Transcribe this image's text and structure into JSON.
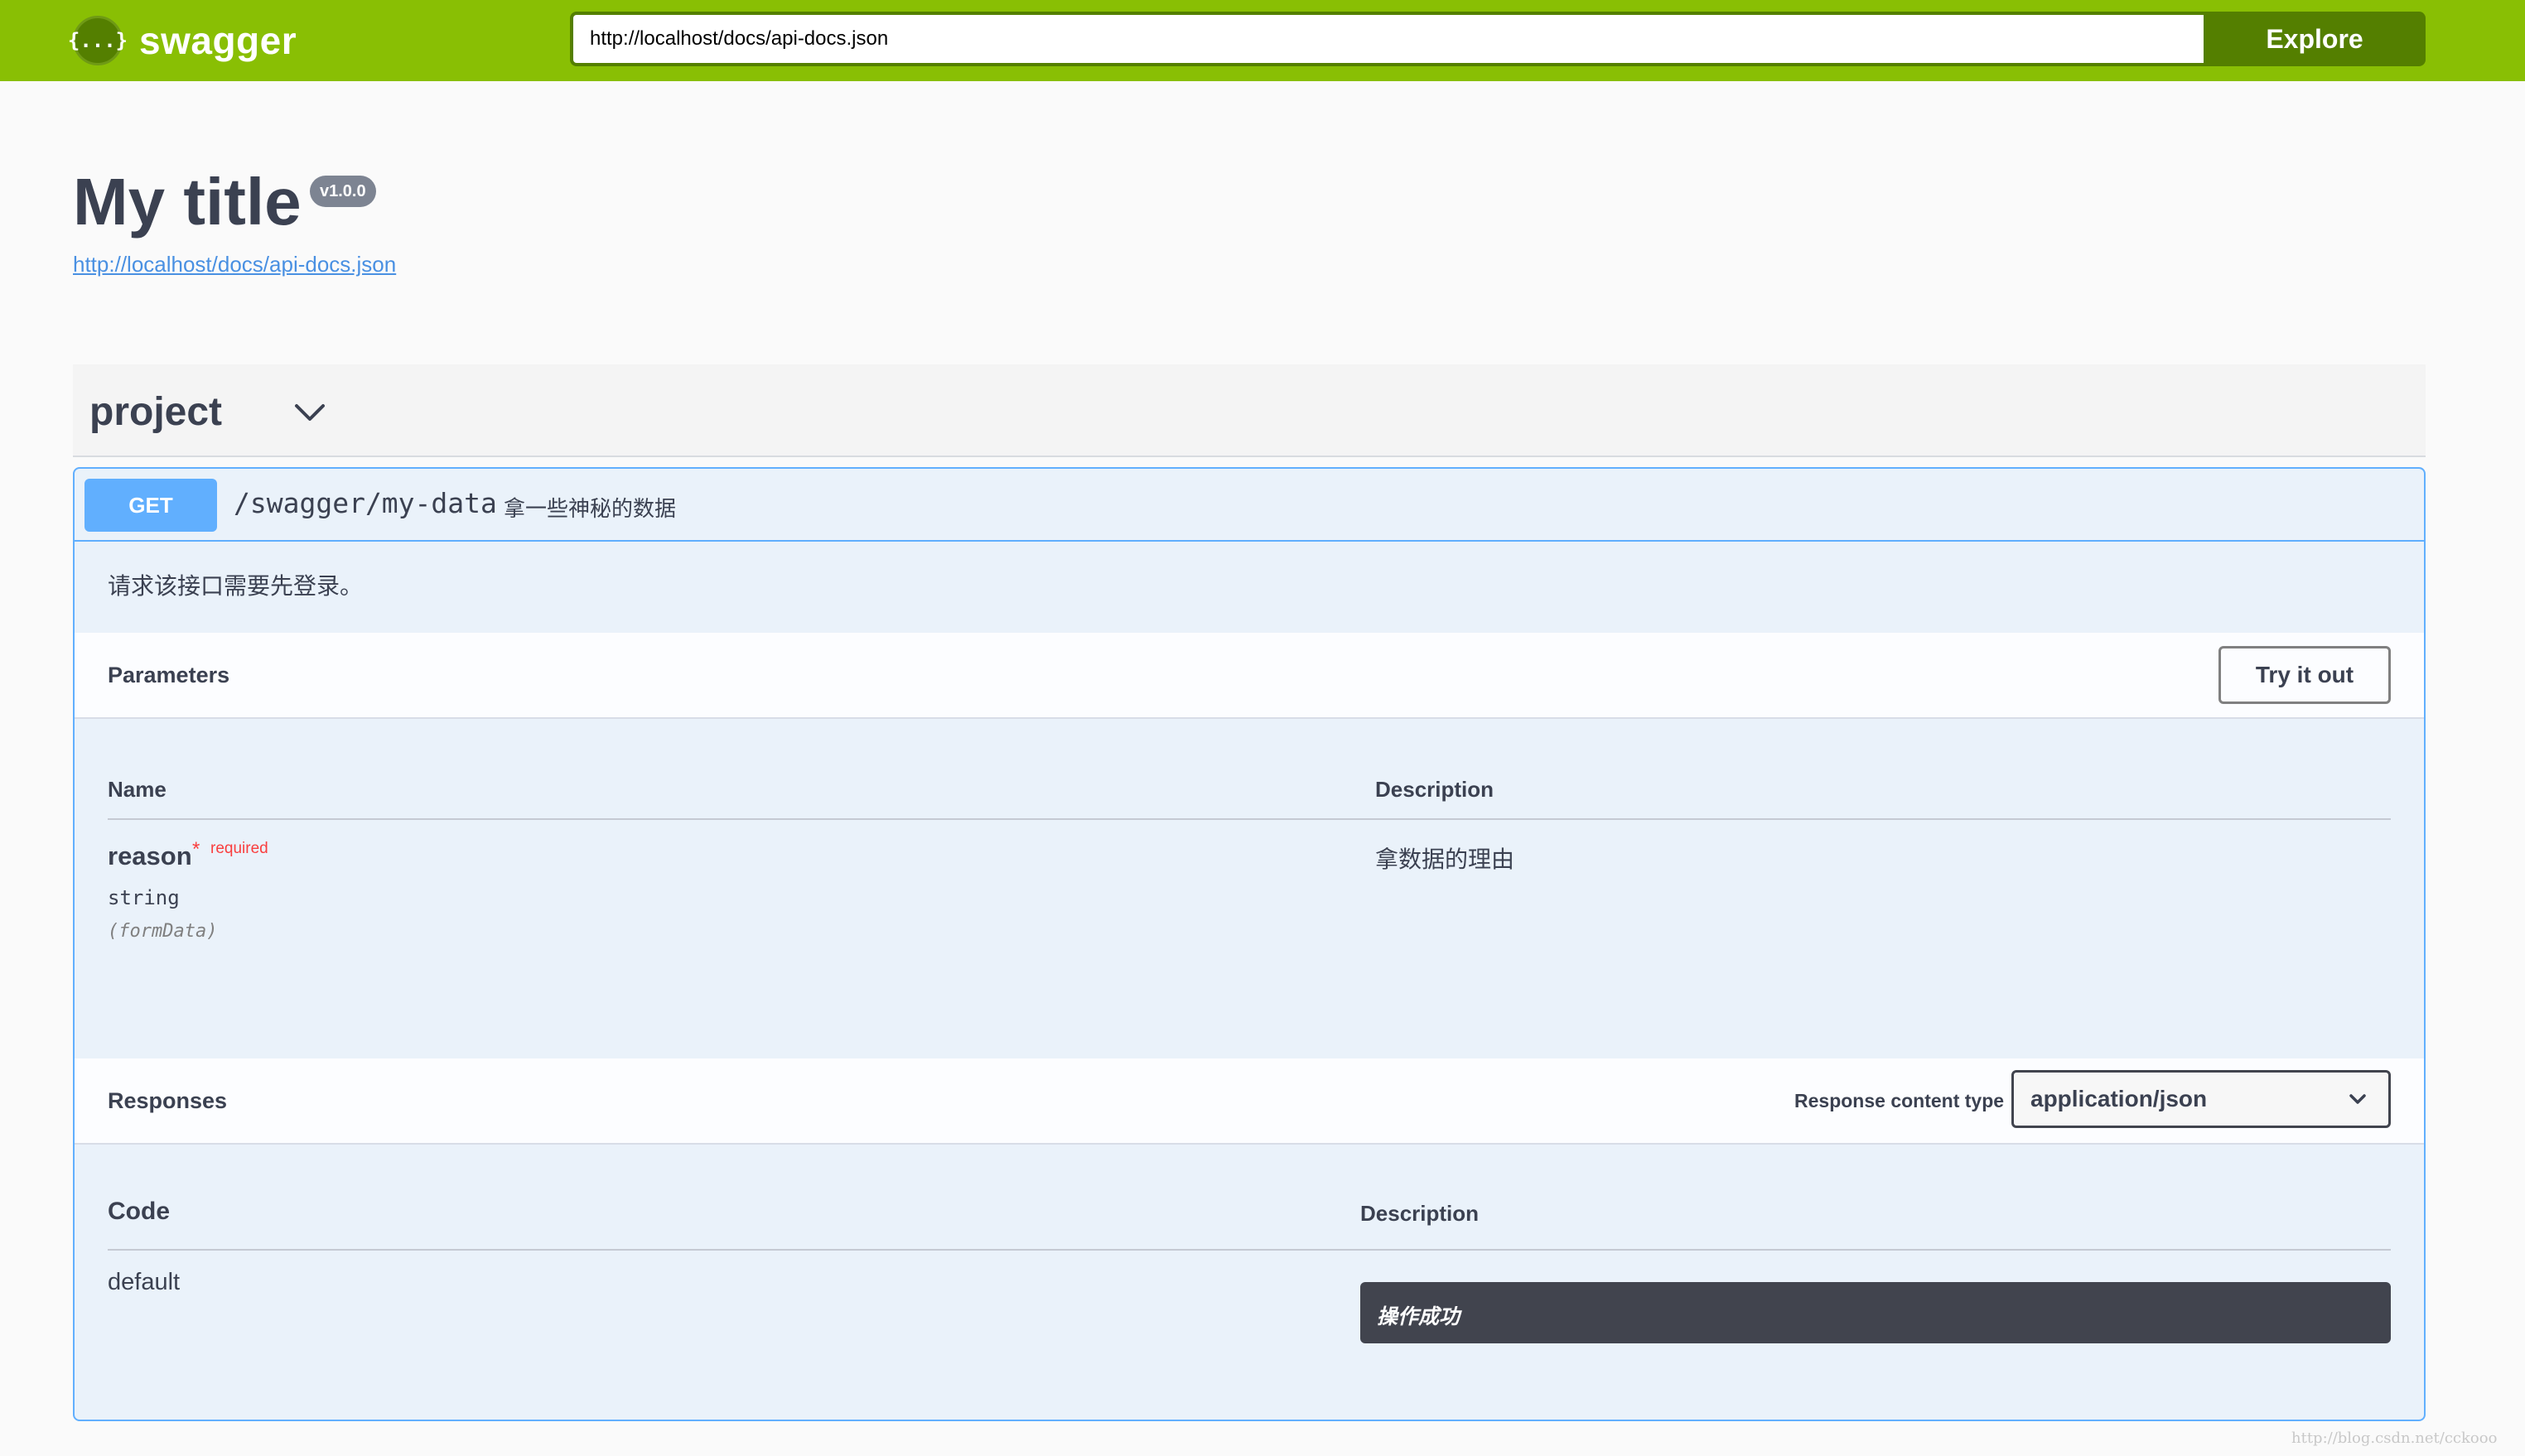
{
  "topbar": {
    "logo_mark": "{...}",
    "logo_text": "swagger",
    "url_value": "http://localhost/docs/api-docs.json",
    "explore_label": "Explore",
    "brand_color": "#89bf04",
    "accent_color": "#547f00"
  },
  "info": {
    "title": "My title",
    "version": "v1.0.0",
    "spec_url": "http://localhost/docs/api-docs.json"
  },
  "tag": {
    "name": "project",
    "icon": "chevron-down-icon"
  },
  "operation": {
    "method": "GET",
    "method_color": "#61affe",
    "path": "/swagger/my-data",
    "summary": "拿一些神秘的数据",
    "note": "请求该接口需要先登录。",
    "parameters": {
      "title": "Parameters",
      "try_label": "Try it out",
      "col_name": "Name",
      "col_description": "Description",
      "items": [
        {
          "name": "reason",
          "required_mark": "*",
          "required_label": "required",
          "type": "string",
          "in": "(formData)",
          "description": "拿数据的理由"
        }
      ]
    },
    "responses": {
      "title": "Responses",
      "content_type_label": "Response content type",
      "content_type_value": "application/json",
      "col_code": "Code",
      "col_description": "Description",
      "items": [
        {
          "code": "default",
          "description": "操作成功"
        }
      ]
    }
  },
  "watermark": "http://blog.csdn.net/cckooo"
}
